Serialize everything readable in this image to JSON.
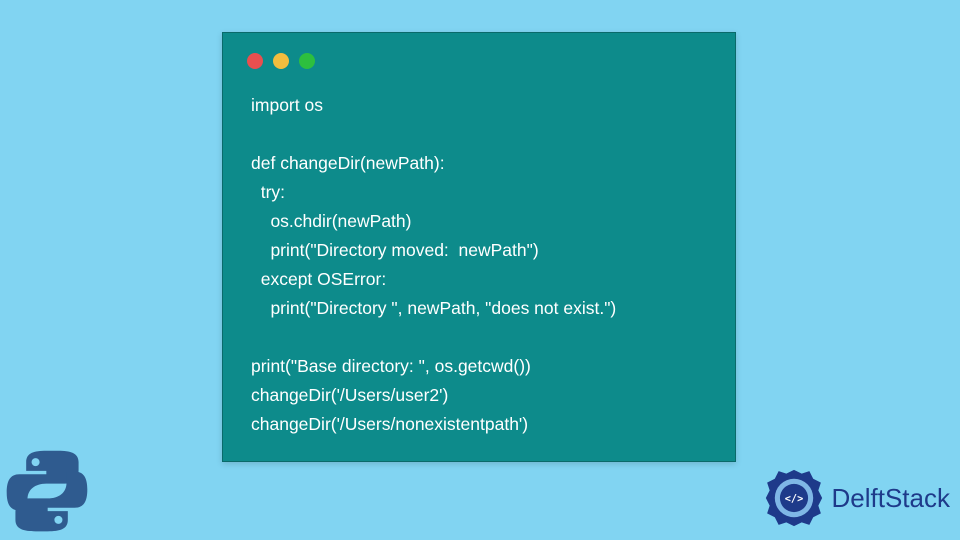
{
  "code": {
    "lines": [
      "import os",
      "",
      "def changeDir(newPath):",
      "  try:",
      "    os.chdir(newPath)",
      "    print(\"Directory moved:  newPath\")",
      "  except OSError:",
      "    print(\"Directory \", newPath, \"does not exist.\")",
      "",
      "print(\"Base directory: \", os.getcwd())",
      "changeDir('/Users/user2')",
      "changeDir('/Users/nonexistentpath')"
    ]
  },
  "branding": {
    "site_name": "DelftStack"
  },
  "colors": {
    "background": "#81d4f2",
    "card": "#0d8b8b",
    "dot_red": "#e94f4f",
    "dot_yellow": "#f2bd3e",
    "dot_green": "#2dbf3e",
    "brand_text": "#1e3a8a"
  }
}
